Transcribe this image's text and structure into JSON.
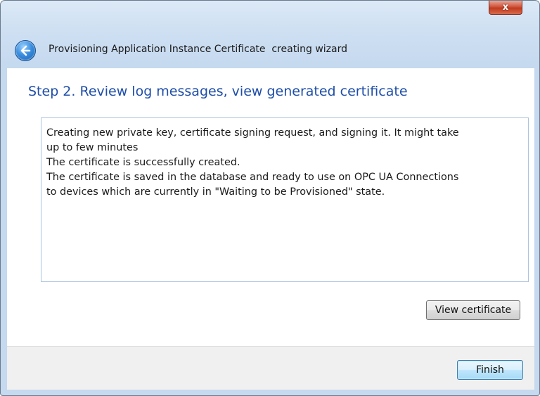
{
  "window": {
    "title": "Provisioning Application Instance Certificate  creating wizard",
    "close_label": "x"
  },
  "page": {
    "step_title": "Step 2. Review log messages, view generated certificate",
    "log_lines": [
      "Creating new private key, certificate signing request, and signing it. It might take",
      "up to few minutes",
      "The certificate is successfully created.",
      "The certificate is saved in the database and ready to use on OPC UA Connections",
      "to devices which are currently in \"Waiting to be Provisioned\" state."
    ],
    "view_certificate_label": "View certificate"
  },
  "footer": {
    "finish_label": "Finish"
  },
  "icons": {
    "back": "back-arrow-icon",
    "close": "close-icon"
  },
  "colors": {
    "step_title": "#1f4ea8",
    "close_button": "#c13a1e",
    "back_button": "#3b8ede"
  }
}
